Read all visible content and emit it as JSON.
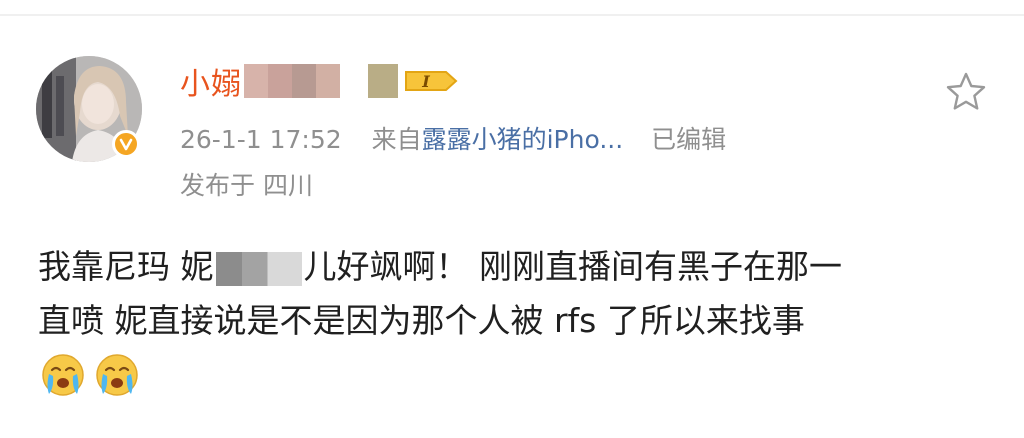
{
  "post": {
    "author": {
      "name": "小嫋",
      "level_badge": "I",
      "verified": true
    },
    "timestamp": "26-1-1 17:52",
    "source_prefix": "来自",
    "source": "露露小猪的iPho...",
    "edited": "已编辑",
    "location": "发布于 四川",
    "content": {
      "line1_a": "我靠尼玛 妮",
      "line1_b": "儿好飒啊！ 刚刚直播间有黑子在那一",
      "line2": "直喷 妮直接说是不是因为那个人被 rfs 了所以来找事"
    },
    "emojis": [
      "crying-face-icon",
      "crying-face-icon"
    ],
    "icons": {
      "favorite": "star-outline-icon",
      "verified": "verified-v-icon"
    },
    "colors": {
      "username": "#e8541e",
      "meta": "#8f8f8f",
      "link": "#4a6fa5",
      "verified": "#f5a623"
    }
  }
}
